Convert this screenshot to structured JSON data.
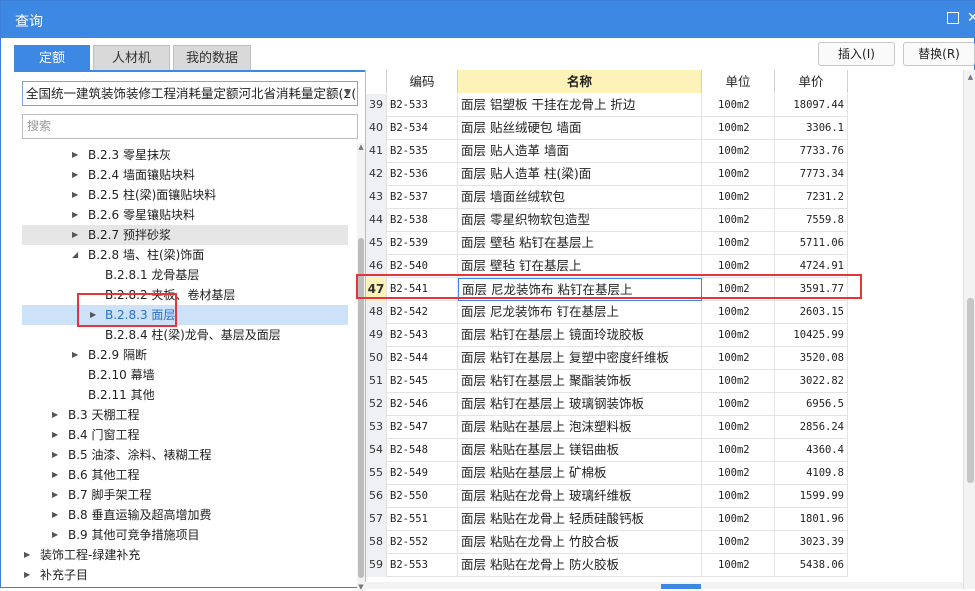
{
  "window": {
    "title": "查询"
  },
  "tabs": [
    "定额",
    "人材机",
    "我的数据"
  ],
  "buttons": {
    "insert": "插入(I)",
    "replace": "替换(R)"
  },
  "library_select": {
    "value": "全国统一建筑装饰装修工程消耗量定额河北省消耗量定额(2("
  },
  "search": {
    "placeholder": "搜索"
  },
  "tree": [
    {
      "label": "B.2.3 零星抹灰",
      "level": 2,
      "caret": "right"
    },
    {
      "label": "B.2.4 墙面镶贴块料",
      "level": 2,
      "caret": "right"
    },
    {
      "label": "B.2.5 柱(梁)面镶贴块料",
      "level": 2,
      "caret": "right"
    },
    {
      "label": "B.2.6 零星镶贴块料",
      "level": 2,
      "caret": "right"
    },
    {
      "label": "B.2.7 预拌砂浆",
      "level": 2,
      "caret": "right",
      "state": "hover"
    },
    {
      "label": "B.2.8 墙、柱(梁)饰面",
      "level": 2,
      "caret": "down"
    },
    {
      "label": "B.2.8.1 龙骨基层",
      "level": 3,
      "caret": ""
    },
    {
      "label": "B.2.8.2 夹板、卷材基层",
      "level": 3,
      "caret": ""
    },
    {
      "label": "B.2.8.3 面层",
      "level": 3,
      "caret": "right",
      "state": "selected"
    },
    {
      "label": "B.2.8.4 柱(梁)龙骨、基层及面层",
      "level": 3,
      "caret": ""
    },
    {
      "label": "B.2.9 隔断",
      "level": 2,
      "caret": "right"
    },
    {
      "label": "B.2.10 幕墙",
      "level": 2,
      "caret": ""
    },
    {
      "label": "B.2.11 其他",
      "level": 2,
      "caret": ""
    },
    {
      "label": "B.3 天棚工程",
      "level": 1,
      "caret": "right"
    },
    {
      "label": "B.4 门窗工程",
      "level": 1,
      "caret": "right"
    },
    {
      "label": "B.5 油漆、涂料、裱糊工程",
      "level": 1,
      "caret": "right"
    },
    {
      "label": "B.6 其他工程",
      "level": 1,
      "caret": "right"
    },
    {
      "label": "B.7 脚手架工程",
      "level": 1,
      "caret": "right"
    },
    {
      "label": "B.8 垂直运输及超高增加费",
      "level": 1,
      "caret": "right"
    },
    {
      "label": "B.9 其他可竞争措施项目",
      "level": 1,
      "caret": "right"
    },
    {
      "label": "装饰工程-绿建补充",
      "level": 0,
      "caret": "right"
    },
    {
      "label": "补充子目",
      "level": 0,
      "caret": "right"
    }
  ],
  "grid": {
    "columns": [
      "",
      "编码",
      "名称",
      "单位",
      "单价"
    ],
    "current_row": "47",
    "rows": [
      {
        "no": "39",
        "code": "B2-533",
        "name": "面层 铝塑板 干挂在龙骨上 折边",
        "unit": "100m2",
        "price": "18097.44"
      },
      {
        "no": "40",
        "code": "B2-534",
        "name": "面层 贴丝绒硬包 墙面",
        "unit": "100m2",
        "price": "3306.1"
      },
      {
        "no": "41",
        "code": "B2-535",
        "name": "面层 贴人造革 墙面",
        "unit": "100m2",
        "price": "7733.76"
      },
      {
        "no": "42",
        "code": "B2-536",
        "name": "面层 贴人造革 柱(梁)面",
        "unit": "100m2",
        "price": "7773.34"
      },
      {
        "no": "43",
        "code": "B2-537",
        "name": "面层 墙面丝绒软包",
        "unit": "100m2",
        "price": "7231.2"
      },
      {
        "no": "44",
        "code": "B2-538",
        "name": "面层 零星织物软包造型",
        "unit": "100m2",
        "price": "7559.8"
      },
      {
        "no": "45",
        "code": "B2-539",
        "name": "面层 壁毡 粘钉在基层上",
        "unit": "100m2",
        "price": "5711.06"
      },
      {
        "no": "46",
        "code": "B2-540",
        "name": "面层 壁毡 钉在基层上",
        "unit": "100m2",
        "price": "4724.91"
      },
      {
        "no": "47",
        "code": "B2-541",
        "name": "面层 尼龙装饰布 粘钉在基层上",
        "unit": "100m2",
        "price": "3591.77"
      },
      {
        "no": "48",
        "code": "B2-542",
        "name": "面层 尼龙装饰布 钉在基层上",
        "unit": "100m2",
        "price": "2603.15"
      },
      {
        "no": "49",
        "code": "B2-543",
        "name": "面层 粘钉在基层上 镜面玲珑胶板",
        "unit": "100m2",
        "price": "10425.99"
      },
      {
        "no": "50",
        "code": "B2-544",
        "name": "面层 粘钉在基层上 复塑中密度纤维板",
        "unit": "100m2",
        "price": "3520.08"
      },
      {
        "no": "51",
        "code": "B2-545",
        "name": "面层 粘钉在基层上 聚酯装饰板",
        "unit": "100m2",
        "price": "3022.82"
      },
      {
        "no": "52",
        "code": "B2-546",
        "name": "面层 粘钉在基层上 玻璃钢装饰板",
        "unit": "100m2",
        "price": "6956.5"
      },
      {
        "no": "53",
        "code": "B2-547",
        "name": "面层 粘贴在基层上 泡沫塑料板",
        "unit": "100m2",
        "price": "2856.24"
      },
      {
        "no": "54",
        "code": "B2-548",
        "name": "面层 粘贴在基层上 镁铝曲板",
        "unit": "100m2",
        "price": "4360.4"
      },
      {
        "no": "55",
        "code": "B2-549",
        "name": "面层 粘贴在基层上 矿棉板",
        "unit": "100m2",
        "price": "4109.8"
      },
      {
        "no": "56",
        "code": "B2-550",
        "name": "面层 粘贴在龙骨上 玻璃纤维板",
        "unit": "100m2",
        "price": "1599.99"
      },
      {
        "no": "57",
        "code": "B2-551",
        "name": "面层 粘贴在龙骨上 轻质硅酸钙板",
        "unit": "100m2",
        "price": "1801.96"
      },
      {
        "no": "58",
        "code": "B2-552",
        "name": "面层 粘贴在龙骨上 竹胶合板",
        "unit": "100m2",
        "price": "3023.39"
      },
      {
        "no": "59",
        "code": "B2-553",
        "name": "面层 粘贴在龙骨上 防火胶板",
        "unit": "100m2",
        "price": "5438.06"
      }
    ]
  },
  "colors": {
    "accent": "#3c88e3",
    "highlight_box": "#e5343a",
    "header_name_bg": "#fdf2b8",
    "selected_tree": "#cde2f8"
  },
  "icons": {
    "maximize": "maximize-icon",
    "close": "close-icon",
    "expand": "caret-right-icon",
    "collapse": "caret-down-icon"
  }
}
